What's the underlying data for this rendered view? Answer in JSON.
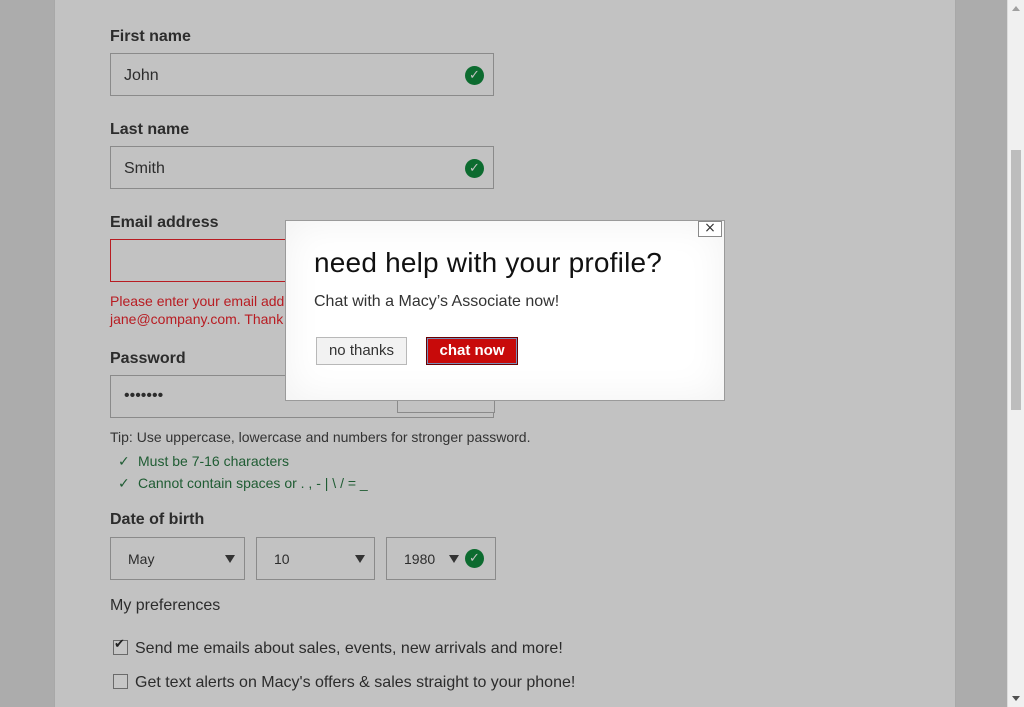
{
  "form": {
    "first_name": {
      "label": "First name",
      "value": "John"
    },
    "last_name": {
      "label": "Last name",
      "value": "Smith"
    },
    "email": {
      "label": "Email address",
      "error_line1": "Please enter your email add",
      "error_line2": "jane@company.com. Thank"
    },
    "password": {
      "label": "Password",
      "value": "•••••••"
    },
    "tip": "Tip: Use uppercase, lowercase and numbers for stronger password.",
    "rules": [
      "Must be 7-16 characters",
      "Cannot contain spaces or . , - | \\ / = _"
    ],
    "dob": {
      "label": "Date of birth",
      "month": "May",
      "day": "10",
      "year": "1980"
    },
    "preferences": {
      "title": "My preferences",
      "email_opt": {
        "label": "Send me emails about sales, events, new arrivals and more!",
        "checked": true
      },
      "text_opt": {
        "label": "Get text alerts on Macy's offers & sales straight to your phone!",
        "checked": false
      }
    }
  },
  "modal": {
    "title": "need help with your profile?",
    "subtitle": "Chat with a Macy’s Associate now!",
    "close_glyph": "×",
    "no_label": "no thanks",
    "chat_label": "chat now"
  },
  "colors": {
    "accent": "#c80a0a",
    "success": "#0c6b2f",
    "error": "#b81c22"
  },
  "icons": {
    "valid": "check-circle-icon",
    "close": "close-icon",
    "dropdown": "caret-down-icon",
    "rule": "checkmark-icon"
  }
}
